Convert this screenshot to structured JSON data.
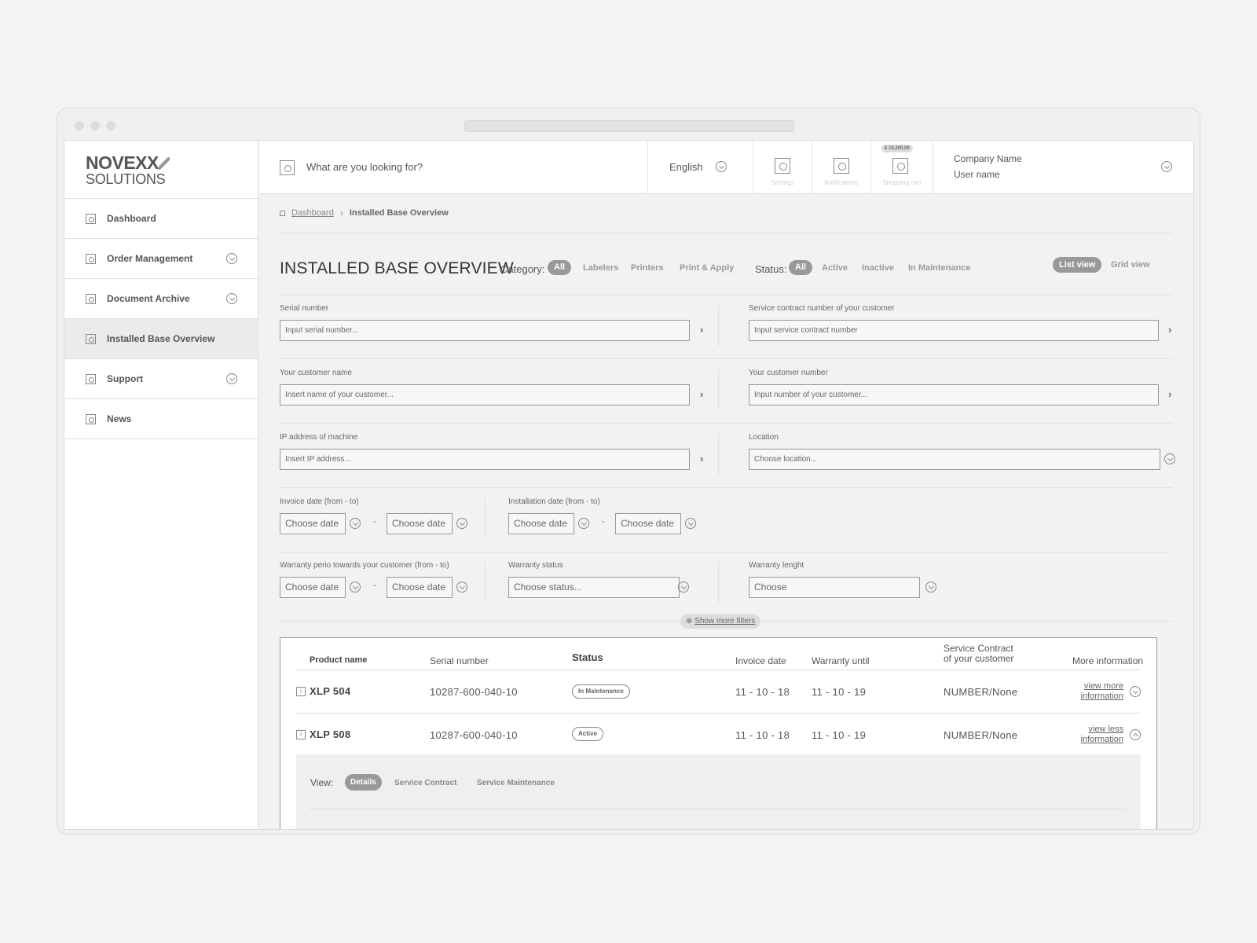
{
  "logo": {
    "main": "NOVEXX",
    "sub": "SOLUTIONS"
  },
  "sidebar": {
    "items": [
      {
        "label": "Dashboard",
        "has_chevron": false,
        "active": false
      },
      {
        "label": "Order Management",
        "has_chevron": true,
        "active": false
      },
      {
        "label": "Document Archive",
        "has_chevron": true,
        "active": false
      },
      {
        "label": "Installed Base Overview",
        "has_chevron": false,
        "active": true
      },
      {
        "label": "Support",
        "has_chevron": true,
        "active": false
      },
      {
        "label": "News",
        "has_chevron": false,
        "active": false
      }
    ]
  },
  "topbar": {
    "search_placeholder": "What are you looking for?",
    "language": "English",
    "settings_label": "Settings",
    "notifications_label": "Notifications",
    "cart_label": "Shopping cart",
    "cart_badge": "€ 10,200,00",
    "company": "Company Name",
    "user": "User name"
  },
  "breadcrumb": {
    "home": "Dashboard",
    "current": "Installed Base Overview"
  },
  "page": {
    "title": "INSTALLED BASE OVERVIEW",
    "category_label": "Category:",
    "categories": [
      "All",
      "Labelers",
      "Printers",
      "Print & Apply"
    ],
    "status_label": "Status:",
    "statuses": [
      "All",
      "Active",
      "Inactive",
      "In Maintenance"
    ],
    "list_view": "List view",
    "grid_view": "Grid view"
  },
  "filters": {
    "serial_label": "Serial number",
    "serial_placeholder": "Input serial number...",
    "service_contract_label": "Service contract number of your customer",
    "service_contract_placeholder": "Input service contract number",
    "customer_name_label": "Your customer name",
    "customer_name_placeholder": "Insert name of your customer...",
    "customer_number_label": "Your customer number",
    "customer_number_placeholder": "Input number of your customer...",
    "ip_label": "IP address of machine",
    "ip_placeholder": "Insert IP address...",
    "location_label": "Location",
    "location_placeholder": "Choose location...",
    "invoice_date_label": "Invoice date (from - to)",
    "installation_date_label": "Installation date (from - to)",
    "warranty_period_label": "Warranty perio towards your customer (from - to)",
    "warranty_status_label": "Warranty status",
    "warranty_status_placeholder": "Choose status...",
    "warranty_length_label": "Warranty lenght",
    "warranty_length_placeholder": "Choose",
    "date_placeholder": "Choose date",
    "range_sep": "-",
    "show_more": "Show more filters"
  },
  "table": {
    "headers": {
      "product": "Product name",
      "serial": "Serial number",
      "status": "Status",
      "invoice": "Invoice date",
      "warranty": "Warranty until",
      "service_1": "Service Contract",
      "service_2": "of your customer",
      "more": "More information"
    },
    "rows": [
      {
        "product": "XLP 504",
        "serial": "10287-600-040-10",
        "status": "In Maintenance",
        "invoice": "11 - 10 - 18",
        "warranty": "11 - 10 - 19",
        "service": "NUMBER/None",
        "link_1": "view more",
        "link_2": "information"
      },
      {
        "product": "XLP 508",
        "serial": "10287-600-040-10",
        "status": "Active",
        "invoice": "11 - 10 - 18",
        "warranty": "11 - 10 - 19",
        "service": "NUMBER/None",
        "link_1": "view less",
        "link_2": "information"
      }
    ],
    "detail": {
      "view_label": "View:",
      "tabs": [
        "Details",
        "Service Contract",
        "Service Maintenance"
      ]
    }
  }
}
